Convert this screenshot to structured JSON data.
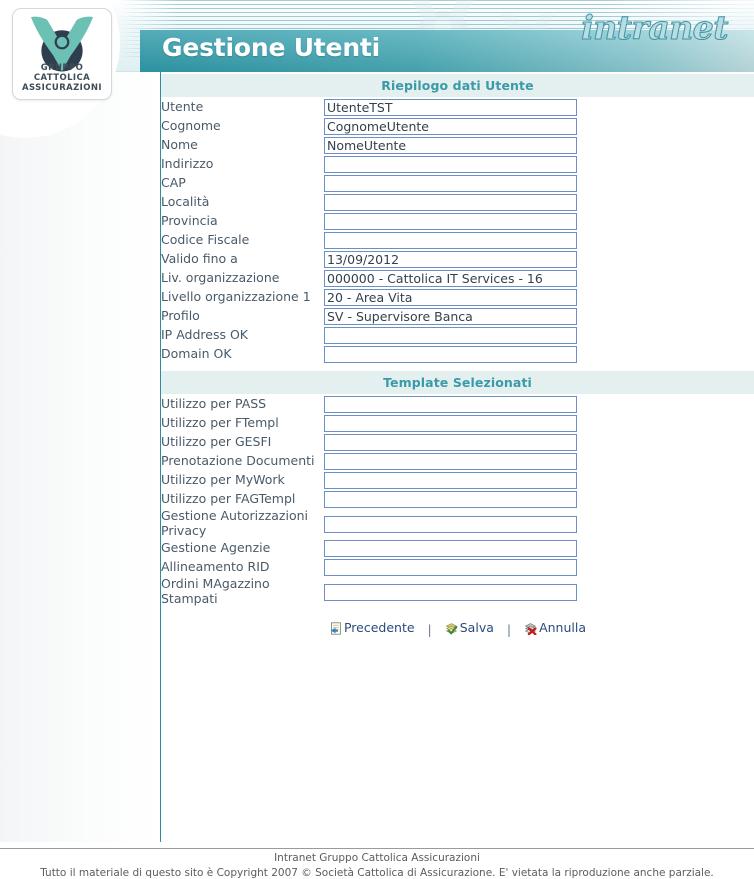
{
  "header": {
    "brand_logo_lines": [
      "GRUPPO",
      "CATTOLICA",
      "ASSICURAZIONI"
    ],
    "wordmark": "intranet",
    "page_title": "Gestione Utenti"
  },
  "colors": {
    "title_band_teal": "#2f9aa9",
    "section_header_bg": "#e4eff0",
    "section_header_text": "#3a9aa8",
    "input_border": "#6e8fc4",
    "label_text": "#4a5a68",
    "link_text": "#2b4b7c",
    "divider_teal": "#2e8d99",
    "logo_teal": "#6cc0b4",
    "logo_navy": "#2f3e4f"
  },
  "sections": [
    {
      "id": "riepilogo",
      "title": "Riepilogo dati Utente",
      "fields": [
        {
          "label": "Utente",
          "value": "UtenteTST"
        },
        {
          "label": "Cognome",
          "value": "CognomeUtente"
        },
        {
          "label": "Nome",
          "value": "NomeUtente"
        },
        {
          "label": "Indirizzo",
          "value": ""
        },
        {
          "label": "CAP",
          "value": ""
        },
        {
          "label": "Località",
          "value": ""
        },
        {
          "label": "Provincia",
          "value": ""
        },
        {
          "label": "Codice Fiscale",
          "value": ""
        },
        {
          "label": "Valido fino a",
          "value": "13/09/2012"
        },
        {
          "label": "Liv. organizzazione",
          "value": "000000 - Cattolica IT Services - 16"
        },
        {
          "label": "Livello organizzazione 1",
          "value": "20 - Area Vita"
        },
        {
          "label": "Profilo",
          "value": "SV - Supervisore Banca"
        },
        {
          "label": "IP Address OK",
          "value": ""
        },
        {
          "label": "Domain OK",
          "value": ""
        }
      ]
    },
    {
      "id": "template",
      "title": "Template Selezionati",
      "fields": [
        {
          "label": "Utilizzo per PASS",
          "value": ""
        },
        {
          "label": "Utilizzo per FTempl",
          "value": ""
        },
        {
          "label": "Utilizzo per GESFI",
          "value": ""
        },
        {
          "label": "Prenotazione Documenti",
          "value": ""
        },
        {
          "label": "Utilizzo per MyWork",
          "value": ""
        },
        {
          "label": "Utilizzo per FAGTempl",
          "value": ""
        },
        {
          "label": "Gestione Autorizzazioni Privacy",
          "value": ""
        },
        {
          "label": "Gestione Agenzie",
          "value": ""
        },
        {
          "label": "Allineamento RID",
          "value": ""
        },
        {
          "label": "Ordini MAgazzino Stampati",
          "value": ""
        }
      ]
    }
  ],
  "actions": [
    {
      "id": "precedente",
      "label": "Precedente",
      "icon": "back-page-icon"
    },
    {
      "id": "salva",
      "label": "Salva",
      "icon": "save-check-icon"
    },
    {
      "id": "annulla",
      "label": "Annulla",
      "icon": "cancel-x-icon"
    }
  ],
  "action_separator": "|",
  "footer": {
    "line1": "Intranet Gruppo Cattolica Assicurazioni",
    "line2": "Tutto il materiale di questo sito è Copyright 2007 © Società Cattolica di Assicurazione. E' vietata la riproduzione anche parziale."
  }
}
